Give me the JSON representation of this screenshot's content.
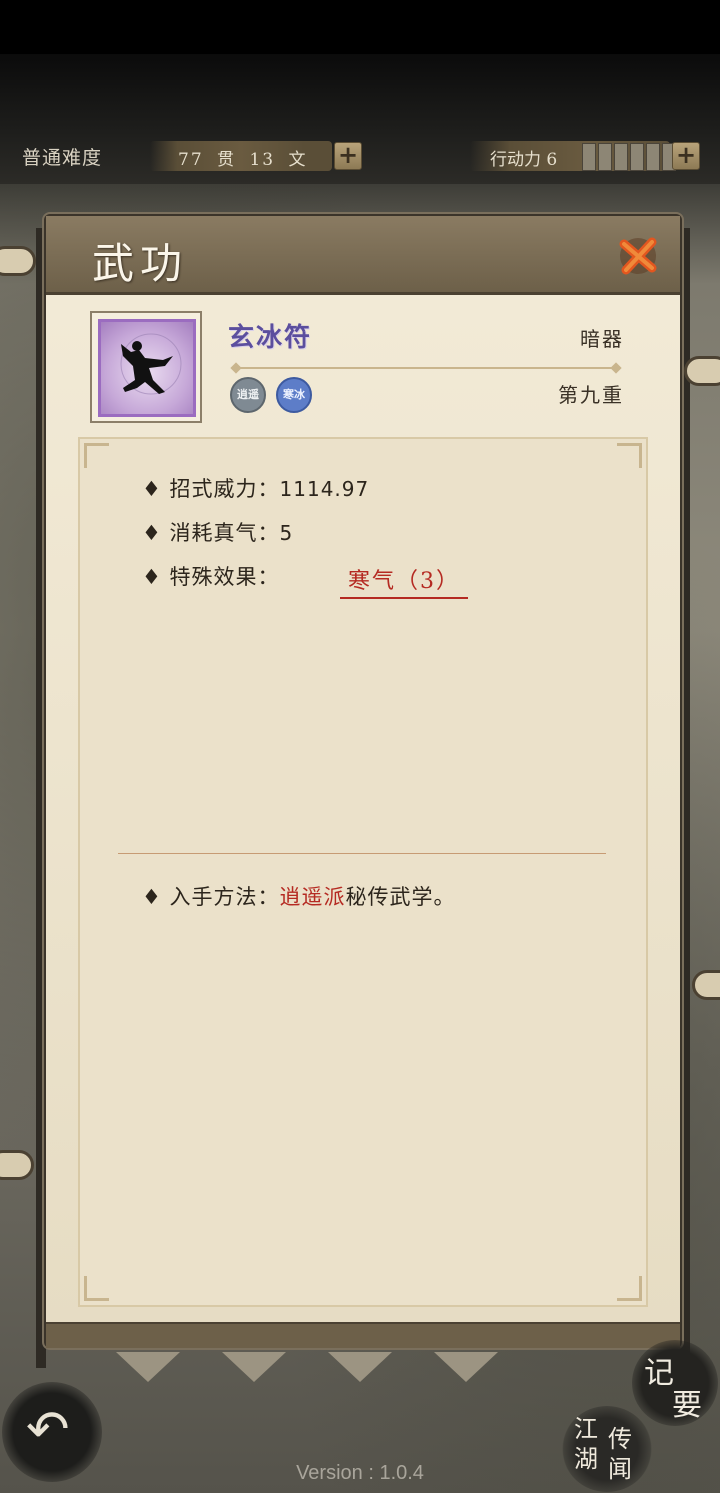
{
  "header": {
    "difficulty": "普通难度",
    "money": "77 贯 13 文",
    "action_label": "行动力 6",
    "action_pips": 6
  },
  "panel": {
    "title": "武功",
    "skill": {
      "name": "玄冰符",
      "type": "暗器",
      "level": "第九重",
      "badges": [
        "逍遥",
        "寒冰"
      ]
    },
    "stats": [
      {
        "label": "♦ 招式威力：",
        "value": "1114.97"
      },
      {
        "label": "♦ 消耗真气：",
        "value": "5"
      },
      {
        "label": "♦ 特殊效果：",
        "value": ""
      }
    ],
    "effect_link": "寒气（3）",
    "obtain": {
      "label": "♦ 入手方法：",
      "sect": "逍遥派",
      "rest": "秘传武学。"
    }
  },
  "buttons": {
    "memo": [
      "记",
      "要"
    ],
    "news_left": "江湖",
    "news_right": "传闻"
  },
  "version": "Version : 1.0.4",
  "colors": {
    "accent_red": "#b52a22",
    "skill_name": "#5b4e9e",
    "panel_bg": "#efe6cf"
  }
}
